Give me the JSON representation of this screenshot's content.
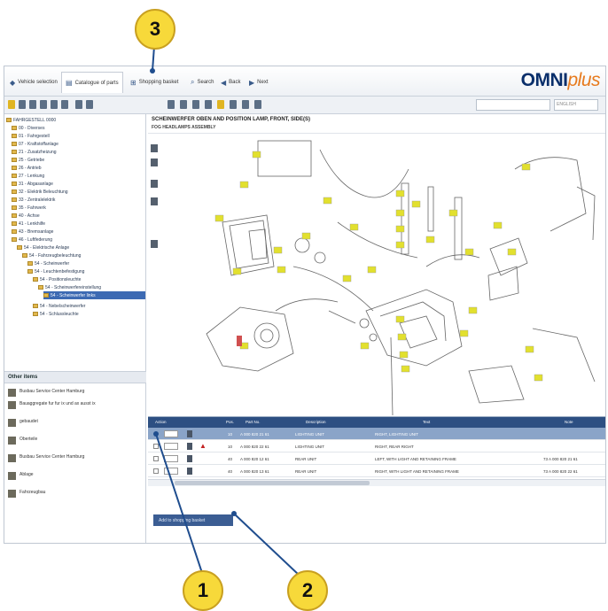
{
  "callouts": {
    "one": "1",
    "two": "2",
    "three": "3"
  },
  "tabs": [
    {
      "label": "Vehicle selection",
      "icon": "car-icon"
    },
    {
      "label": "Catalogue of parts",
      "icon": "book-icon"
    },
    {
      "label": "Shopping basket",
      "icon": "cart-icon"
    },
    {
      "label": "Search",
      "icon": "search-icon"
    },
    {
      "label": "Back",
      "icon": "back-icon"
    },
    {
      "label": "Next",
      "icon": "next-icon"
    }
  ],
  "logo": {
    "main": "OMNI",
    "accent": "plus"
  },
  "search": {
    "placeholder": "",
    "lang": "ENGLISH"
  },
  "tree": {
    "root": "FAHRGESTELL 0000",
    "items": [
      "00 - Diverses",
      "01 - Fahrgestell",
      "07 - Kraftstoffanlage",
      "21 - Zusatzheizung",
      "25 - Getriebe",
      "26 - Antrieb",
      "27 - Lenkung",
      "31 - Abgasanlage",
      "32 - Elektrik Beleuchtung",
      "33 - Zentralelektrik",
      "35 - Fahrwerk",
      "40 - Achse",
      "41 - Lenkhilfe",
      "43 - Bremsanlage",
      "46 - Luftfederung",
      "54 - Elektrische Anlage",
      "54 - Fahrzeugbeleuchtung",
      "54 - Scheinwerfer",
      "54 - Leuchtenbefestigung",
      "54 - Positionsleuchte",
      "54 - Scheinwerfereinstellung",
      "54 - Scheinwerfer links",
      "54 - Nebelscheinwerfer",
      "54 - Schlussleuchte"
    ]
  },
  "other": {
    "title": "Other items",
    "items": [
      "Busbau Service Center Hamburg",
      "Bauaggregate fur fur ix und ax ausst ix",
      "gebaudet",
      "Oberteile",
      "Busbau Service Center Hamburg",
      "Ablage",
      "Fahrzeugbau"
    ]
  },
  "drawing": {
    "title": "SCHEINWERFER OBEN AND POSITION LAMP, FRONT, SIDE(S)",
    "subtitle": "FOG HEADLAMPS ASSEMBLY",
    "labels": [
      "10",
      "20",
      "30",
      "40",
      "50",
      "60",
      "70",
      "80",
      "90",
      "100",
      "110",
      "120",
      "130",
      "140",
      "150",
      "160",
      "170",
      "180",
      "190",
      "200",
      "210",
      "220"
    ]
  },
  "grid": {
    "headers": [
      "Action",
      "Pos.",
      "Part No.",
      "Description",
      "Text",
      "Qty.",
      "Ref.",
      "Note"
    ],
    "rows": [
      {
        "pos": "10",
        "part": "A 000 820 21 61",
        "desc": "LIGHTING UNIT",
        "text": "RIGHT, LIGHTING UNIT",
        "right": ""
      },
      {
        "pos": "10",
        "part": "A 000 820 22 61",
        "desc": "LIGHTING UNIT",
        "text": "RIGHT, REAR RIGHT",
        "right": ""
      },
      {
        "pos": "40",
        "part": "A 000 820 12 61",
        "desc": "REAR UNIT",
        "text": "LEFT, WITH LIGHT AND RETAINING FRAME",
        "right": "73 A 000 820 21 61"
      },
      {
        "pos": "40",
        "part": "A 000 820 13 61",
        "desc": "REAR UNIT",
        "text": "RIGHT, WITH LIGHT AND RETAINING FRAME",
        "right": "73 A 000 820 22 61"
      }
    ]
  },
  "statusbar": {
    "label": "Add to shopping basket"
  }
}
